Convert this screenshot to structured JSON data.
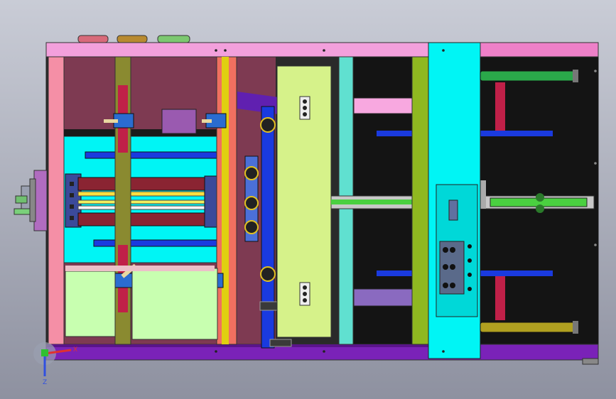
{
  "viewport": {
    "background_top": "#c9ccd6",
    "background_bottom": "#8e91a0"
  },
  "triad": {
    "x_label": "X",
    "z_label": "Z",
    "x_color": "#e03030",
    "y_color": "#30c030",
    "z_color": "#3050e0"
  },
  "palette": {
    "frame_top": "#f3a0dc",
    "frame_left": "#f58fa6",
    "frame_bottom": "#7a22b8",
    "panel_cyan": "#00f5f5",
    "panel_lightgreen": "#d6f28a",
    "panel_olive": "#8fb820",
    "interior_dark": "#141414",
    "interior_maroon": "#7e3a52",
    "rail_blue": "#1a3adf",
    "accent_red": "#d02050",
    "mint": "#c8ffb0"
  }
}
